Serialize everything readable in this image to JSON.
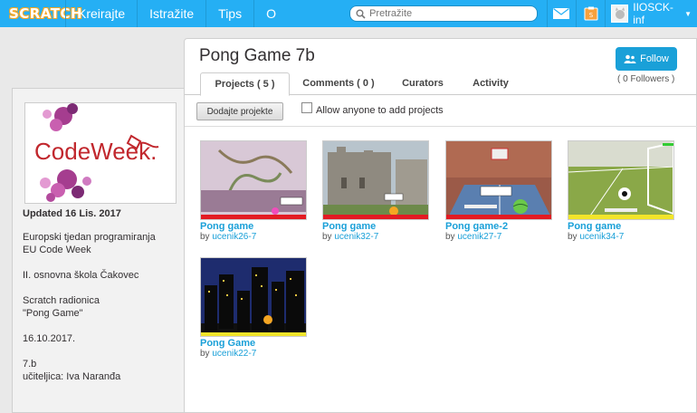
{
  "nav": {
    "logo": "SCRATCH",
    "items": [
      "Kreirajte",
      "Istražite",
      "Tips",
      "O programu"
    ],
    "search_placeholder": "Pretražite",
    "username": "IIOSCK-inf"
  },
  "sidebar": {
    "updated": "Updated 16 Lis. 2017",
    "thumb_caption": "CodeWeek.",
    "lines": [
      "Europski tjedan programiranja",
      "EU Code Week",
      "",
      "II. osnovna škola Čakovec",
      "",
      "Scratch radionica",
      "\"Pong Game\"",
      "",
      "16.10.2017.",
      "",
      "7.b",
      "učiteljica: Iva Naranđa"
    ]
  },
  "gallery": {
    "title": "Pong Game 7b",
    "follow_label": "Follow",
    "followers": "( 0 Followers )",
    "tabs": [
      "Projects ( 5 )",
      "Comments ( 0 )",
      "Curators",
      "Activity"
    ],
    "add_button": "Dodajte projekte",
    "allow_label": "Allow anyone to add projects",
    "by_prefix": "by",
    "projects": [
      {
        "title": "Pong game",
        "author": "ucenik26-7"
      },
      {
        "title": "Pong game",
        "author": "ucenik32-7"
      },
      {
        "title": "Pong game-2",
        "author": "ucenik27-7"
      },
      {
        "title": "Pong game",
        "author": "ucenik34-7"
      },
      {
        "title": "Pong Game",
        "author": "ucenik22-7"
      }
    ]
  },
  "colors": {
    "nav_bg": "#25aff4",
    "link": "#1aa0d8",
    "follow_bg": "#1aa0d8"
  }
}
